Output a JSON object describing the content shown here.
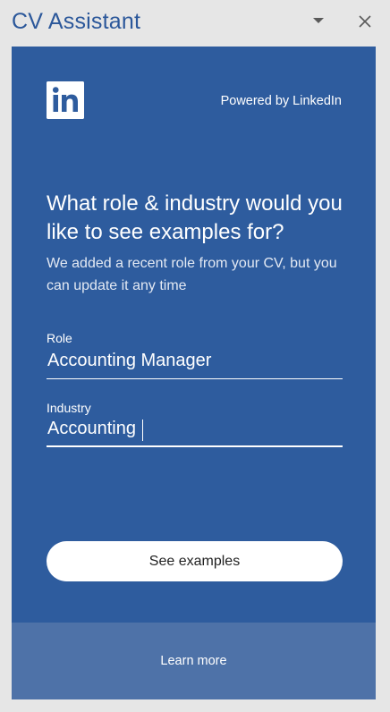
{
  "pane": {
    "title": "CV Assistant",
    "menu_icon": "caret-down-icon",
    "close_icon": "close-icon"
  },
  "card": {
    "logo": "linkedin-logo",
    "logo_text": "in",
    "powered_by": "Powered by LinkedIn",
    "heading": "What role & industry would you like to see examples for?",
    "subtext": "We added a recent role from your CV, but you can update it any time",
    "role": {
      "label": "Role",
      "value": "Accounting Manager"
    },
    "industry": {
      "label": "Industry",
      "value": "Accounting"
    },
    "see_examples_label": "See examples",
    "learn_more_label": "Learn more"
  },
  "colors": {
    "title": "#2b579a",
    "card_background": "#2e5c9e",
    "footer_background": "#4e72a8",
    "pane_background": "#e6e6e6"
  }
}
